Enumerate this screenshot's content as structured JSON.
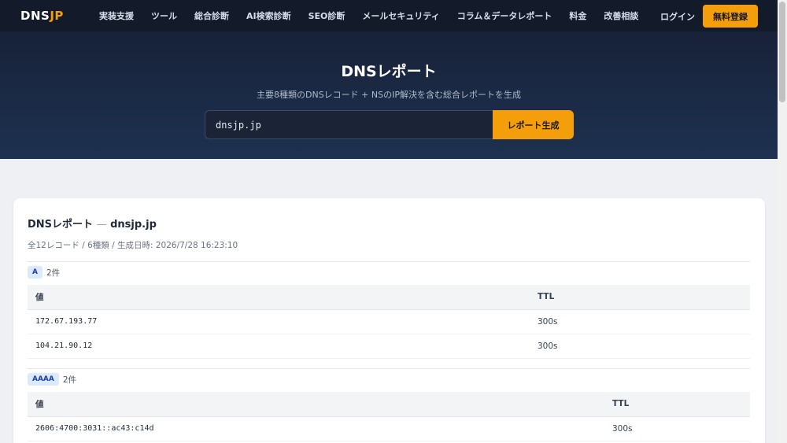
{
  "header": {
    "logo_main": "DNS",
    "logo_accent": "JP",
    "nav": [
      "実装支援",
      "ツール",
      "総合診断",
      "AI検索診断",
      "SEO診断",
      "メールセキュリティ",
      "コラム＆データレポート",
      "料金",
      "改善相談"
    ],
    "login": "ログイン",
    "signup": "無料登録"
  },
  "hero": {
    "title": "DNSレポート",
    "subtitle": "主要8種類のDNSレコード + NSのIP解決を含む総合レポートを生成",
    "search_value": "dnsjp.jp",
    "button": "レポート生成"
  },
  "report": {
    "title_prefix": "DNSレポート",
    "title_dash": "—",
    "title_domain": "dnsjp.jp",
    "meta": "全12レコード / 6種類 / 生成日時: 2026/7/28 16:23:10",
    "sections": [
      {
        "type": "A",
        "count": "2件",
        "headers": [
          "値",
          "TTL"
        ],
        "rows": [
          {
            "value": "172.67.193.77",
            "ttl": "300s"
          },
          {
            "value": "104.21.90.12",
            "ttl": "300s"
          }
        ]
      },
      {
        "type": "AAAA",
        "count": "2件",
        "headers": [
          "値",
          "TTL"
        ],
        "rows": [
          {
            "value": "2606:4700:3031::ac43:c14d",
            "ttl": "300s"
          }
        ]
      }
    ]
  },
  "colors": {
    "accent": "#f59e0b",
    "nav_bg": "#131b2b",
    "hero_bg": "#1b2b47",
    "badge_bg": "#dbeafe",
    "badge_text": "#1e40af"
  }
}
